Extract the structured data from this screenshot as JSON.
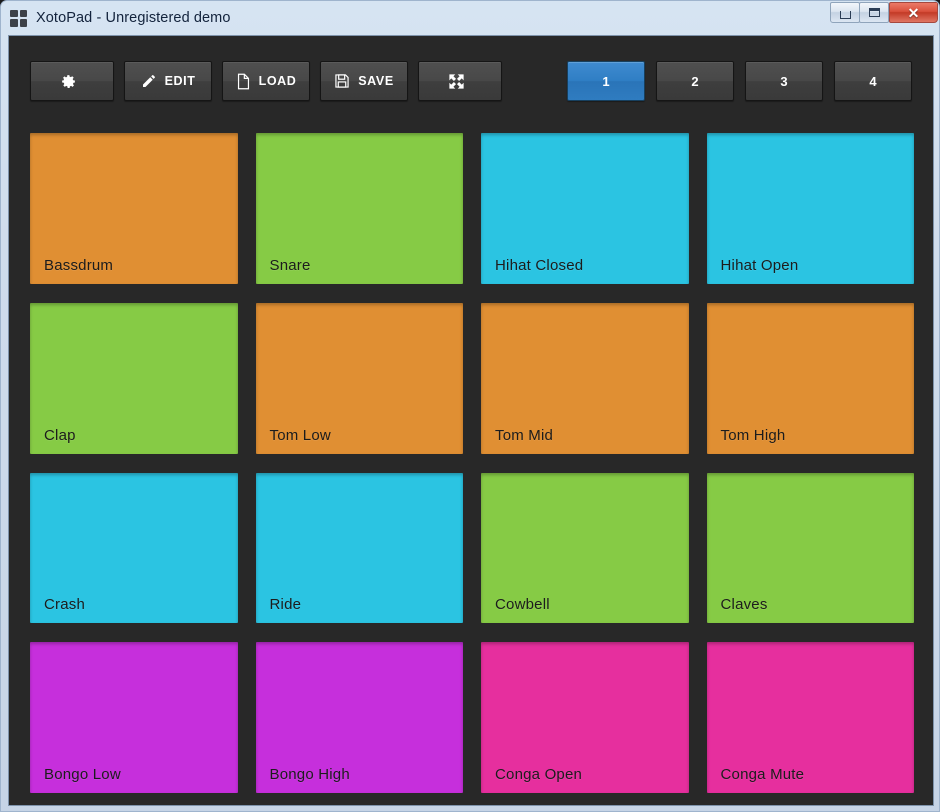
{
  "window": {
    "title": "XotoPad - Unregistered demo",
    "icon": "grid-2x2-icon",
    "controls": {
      "minimize": "minimize-button",
      "maximize": "maximize-button",
      "close_glyph": "✕"
    }
  },
  "toolbar": {
    "buttons": [
      {
        "id": "settings",
        "label": "",
        "icon": "gear-icon"
      },
      {
        "id": "edit",
        "label": "EDIT",
        "icon": "pencil-icon"
      },
      {
        "id": "load",
        "label": "LOAD",
        "icon": "document-icon"
      },
      {
        "id": "save",
        "label": "SAVE",
        "icon": "floppy-disk-icon"
      },
      {
        "id": "fullscreen",
        "label": "",
        "icon": "expand-arrows-icon"
      }
    ],
    "pages": [
      {
        "label": "1",
        "active": true
      },
      {
        "label": "2",
        "active": false
      },
      {
        "label": "3",
        "active": false
      },
      {
        "label": "4",
        "active": false
      }
    ]
  },
  "colors": {
    "orange": "#e08f33",
    "green": "#86cb45",
    "cyan": "#2bc4e2",
    "magenta": "#c62fdc",
    "pink": "#e62f9e",
    "app_background": "#282828",
    "accent_blue": "#2f7ec4",
    "pad_label_text": "#1c1c1c"
  },
  "pads": [
    {
      "label": "Bassdrum",
      "color": "#e08f33"
    },
    {
      "label": "Snare",
      "color": "#86cb45"
    },
    {
      "label": "Hihat Closed",
      "color": "#2bc4e2"
    },
    {
      "label": "Hihat Open",
      "color": "#2bc4e2"
    },
    {
      "label": "Clap",
      "color": "#86cb45"
    },
    {
      "label": "Tom Low",
      "color": "#e08f33"
    },
    {
      "label": "Tom Mid",
      "color": "#e08f33"
    },
    {
      "label": "Tom High",
      "color": "#e08f33"
    },
    {
      "label": "Crash",
      "color": "#2bc4e2"
    },
    {
      "label": "Ride",
      "color": "#2bc4e2"
    },
    {
      "label": "Cowbell",
      "color": "#86cb45"
    },
    {
      "label": "Claves",
      "color": "#86cb45"
    },
    {
      "label": "Bongo Low",
      "color": "#c62fdc"
    },
    {
      "label": "Bongo High",
      "color": "#c62fdc"
    },
    {
      "label": "Conga Open",
      "color": "#e62f9e"
    },
    {
      "label": "Conga Mute",
      "color": "#e62f9e"
    }
  ]
}
